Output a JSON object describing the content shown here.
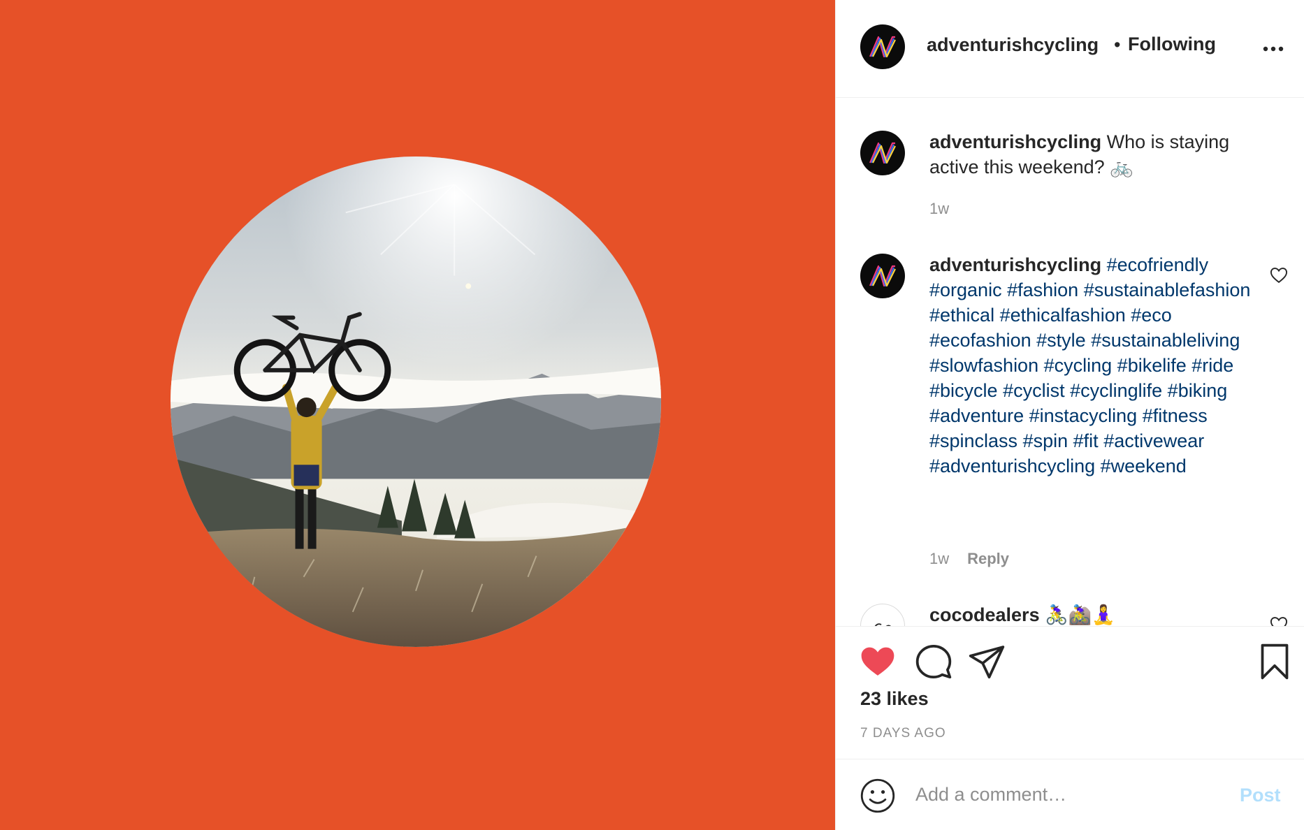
{
  "media": {
    "background_color": "#e65128",
    "alt": "Cyclist lifting a mountain bike overhead on a frosty hilltop above the clouds"
  },
  "post": {
    "username": "adventurishcycling",
    "separator": "•",
    "follow_status": "Following",
    "more_icon": "more-horizontal-icon"
  },
  "comments": [
    {
      "username": "adventurishcycling",
      "text": "Who is staying active this weekend? 🚲",
      "time": "1w"
    },
    {
      "username": "adventurishcycling",
      "hashtags": [
        "#ecofriendly",
        "#organic",
        "#fashion",
        "#sustainablefashion",
        "#ethical",
        "#ethicalfashion",
        "#eco",
        "#ecofashion",
        "#style",
        "#sustainableliving",
        "#slowfashion",
        "#cycling",
        "#bikelife",
        "#ride",
        "#bicycle",
        "#cyclist",
        "#cyclinglife",
        "#biking",
        "#adventure",
        "#instacycling",
        "#fitness",
        "#spinclass",
        "#spin",
        "#fit",
        "#activewear",
        "#adventurishcycling",
        "#weekend"
      ],
      "time": "1w",
      "reply_label": "Reply"
    },
    {
      "username": "cocodealers",
      "text": "🚴‍♀️🚵‍♀️🧘‍♀️"
    }
  ],
  "actions": {
    "like_icon": "heart-filled-icon",
    "comment_icon": "comment-icon",
    "share_icon": "paper-plane-icon",
    "save_icon": "bookmark-icon",
    "like_color": "#ed4956"
  },
  "likes": "23 likes",
  "age": "7 DAYS AGO",
  "add_comment": {
    "placeholder": "Add a comment…",
    "post_label": "Post",
    "post_color": "#b2dffc"
  },
  "theme": {
    "text": "#262626",
    "secondary": "#8e8e8e",
    "hashtag": "#00376b",
    "border": "#efefef"
  }
}
